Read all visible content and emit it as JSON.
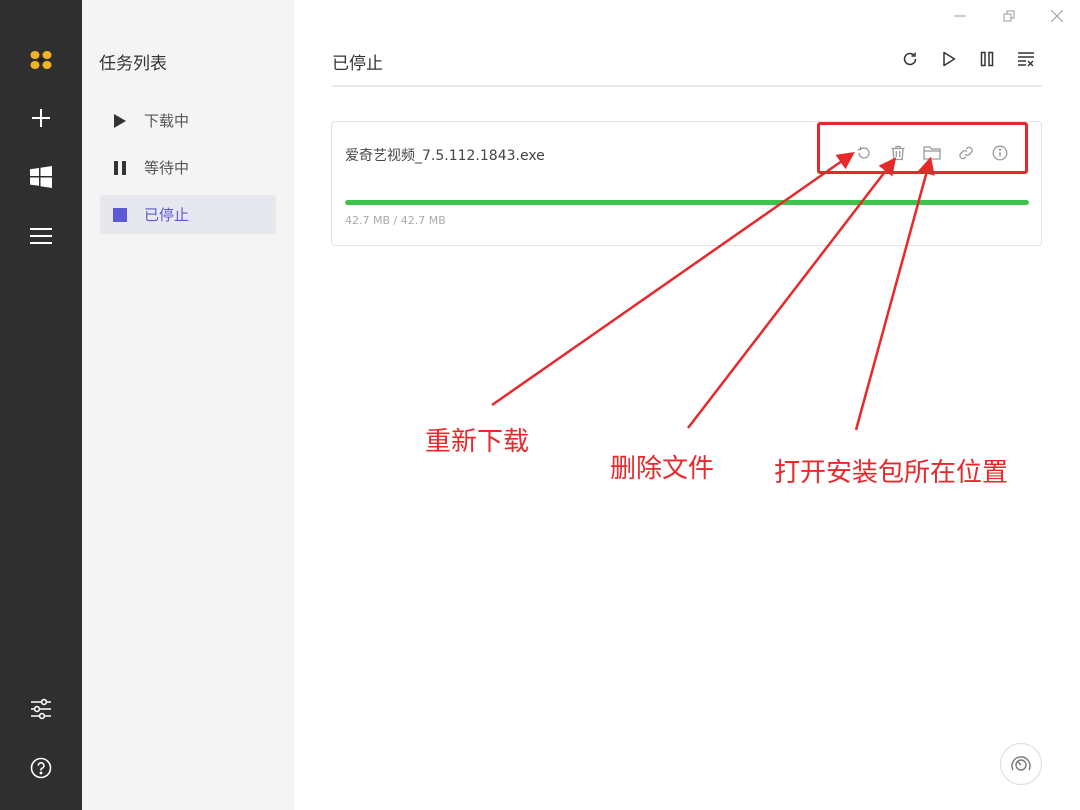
{
  "task_list": {
    "title": "任务列表",
    "items": [
      {
        "label": "下载中",
        "icon": "play-icon"
      },
      {
        "label": "等待中",
        "icon": "pause-icon"
      },
      {
        "label": "已停止",
        "icon": "stop-icon",
        "active": true
      }
    ]
  },
  "main": {
    "title": "已停止",
    "toolbar": [
      "refresh-icon",
      "play-icon",
      "pause-icon",
      "clear-list-icon"
    ]
  },
  "task": {
    "name": "爱奇艺视频_7.5.112.1843.exe",
    "progress": 1.0,
    "size_text": "42.7 MB / 42.7 MB",
    "actions": [
      "redownload-icon",
      "trash-icon",
      "folder-icon",
      "link-icon",
      "info-icon"
    ]
  },
  "annotations": {
    "redownload": "重新下载",
    "delete": "删除文件",
    "open_folder": "打开安装包所在位置"
  },
  "colors": {
    "accent": "#5b5bd6",
    "progress": "#3ec24a",
    "annotation": "#e8282b",
    "rail": "#2f2f2f"
  }
}
